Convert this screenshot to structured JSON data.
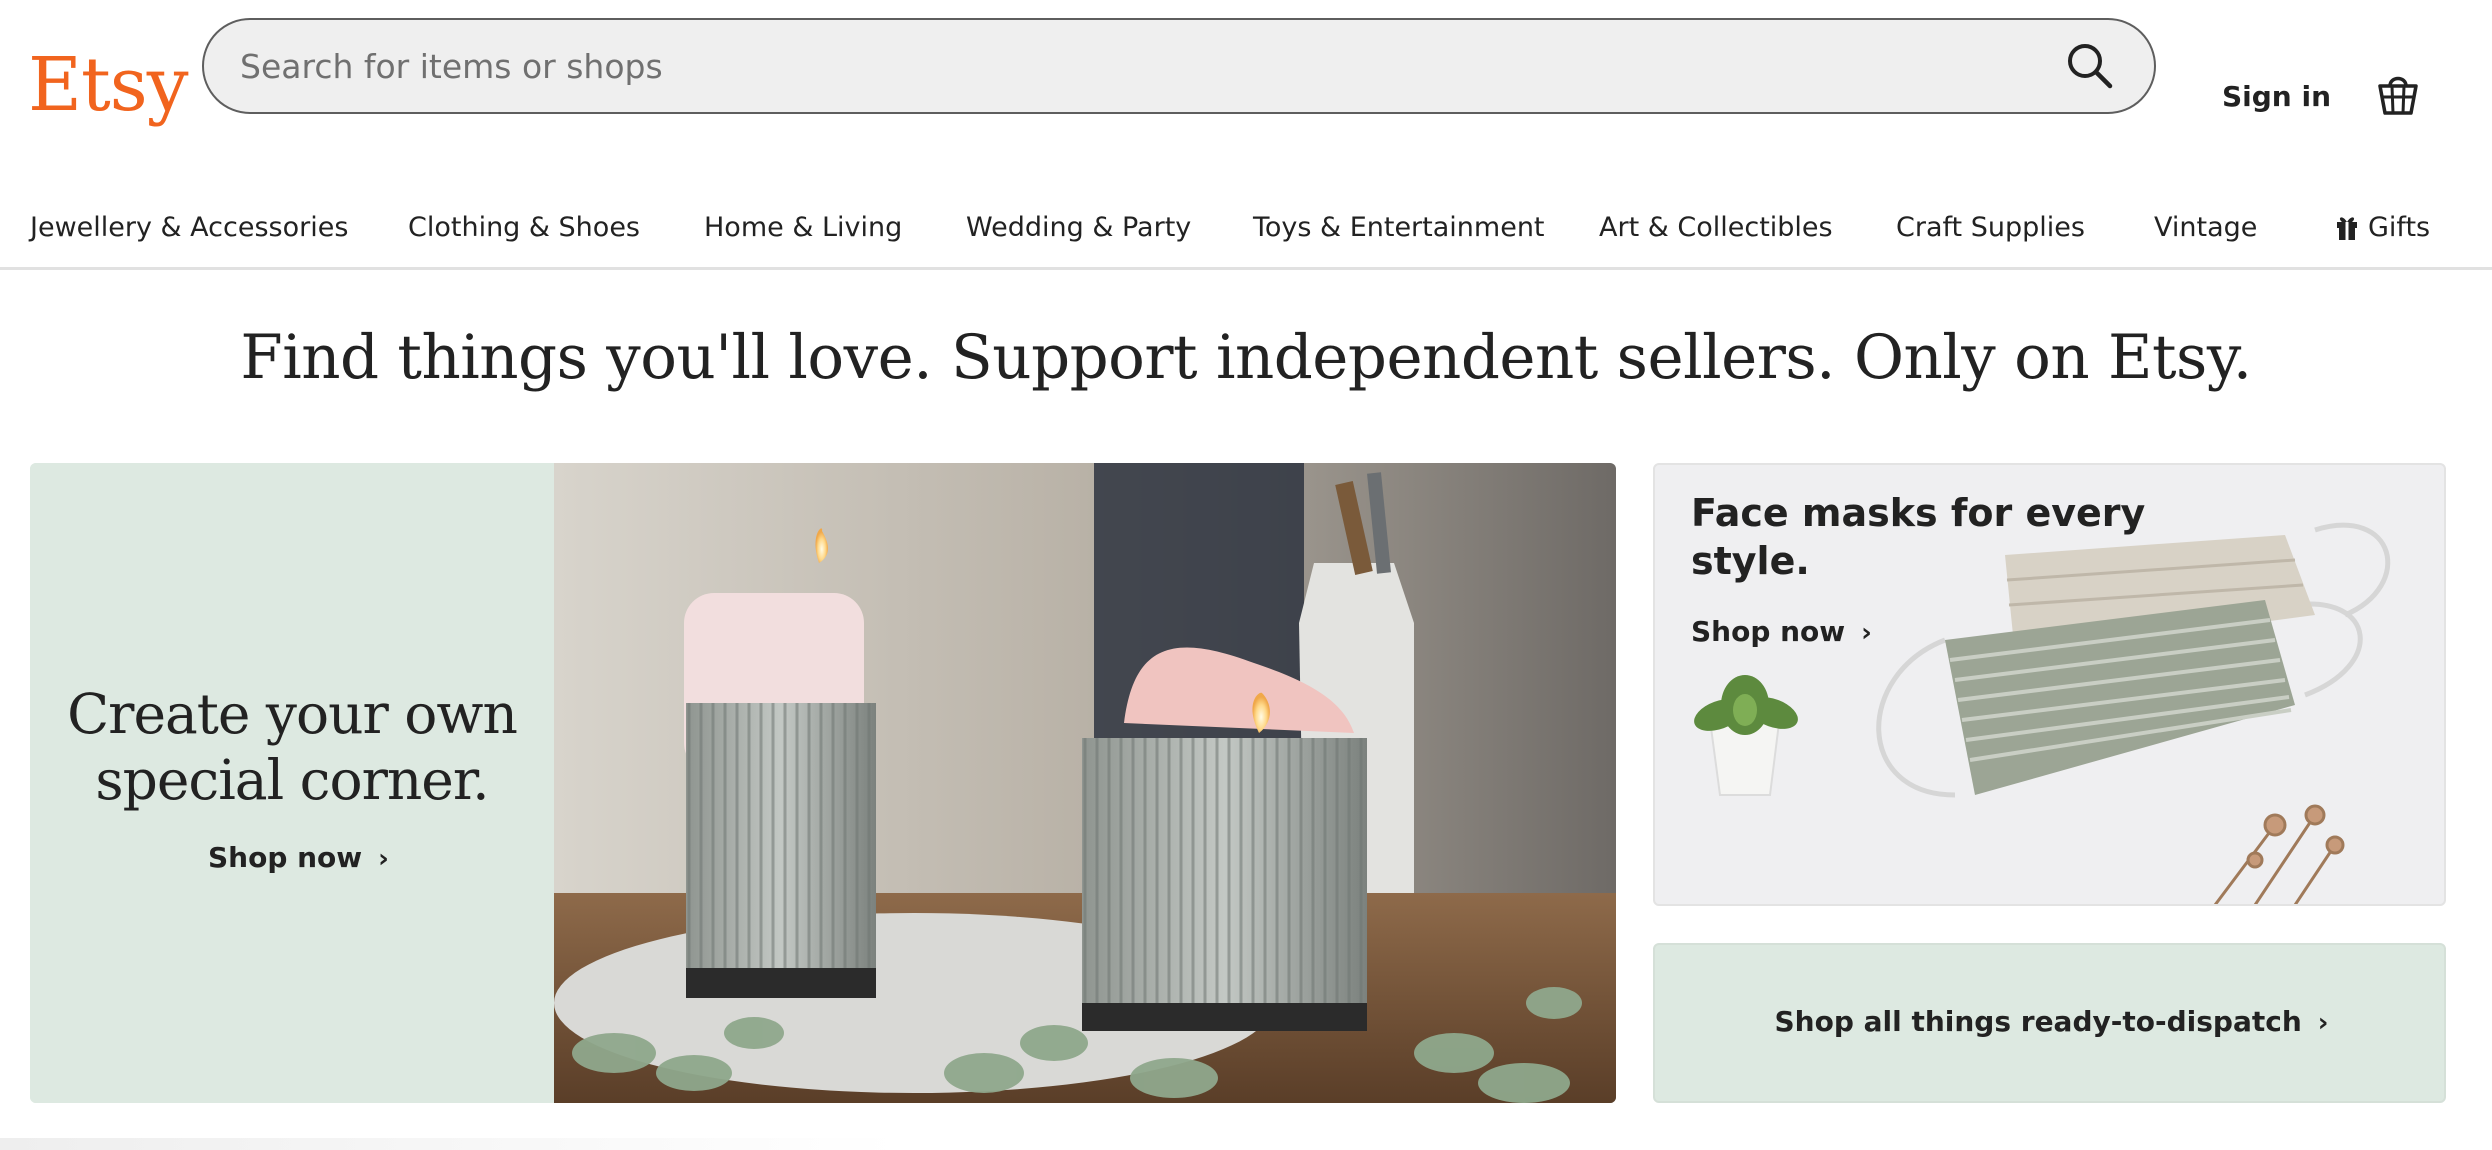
{
  "brand": {
    "logo_text": "Etsy",
    "accent_color": "#f1641e"
  },
  "search": {
    "placeholder": "Search for items or shops",
    "icon": "search-icon"
  },
  "header": {
    "signin_label": "Sign in",
    "basket_icon": "basket-icon"
  },
  "nav": {
    "items": [
      "Jewellery & Accessories",
      "Clothing & Shoes",
      "Home & Living",
      "Wedding & Party",
      "Toys & Entertainment",
      "Art & Collectibles",
      "Craft Supplies",
      "Vintage",
      "Gifts"
    ],
    "gift_icon": "gift-icon"
  },
  "hero": {
    "title": "Find things you'll love. Support independent sellers. Only on Etsy."
  },
  "banner": {
    "heading_line1": "Create your own",
    "heading_line2": "special corner.",
    "cta": "Shop now",
    "background_color": "#dde9e1"
  },
  "masks_card": {
    "title": "Face masks for every style.",
    "cta": "Shop now"
  },
  "dispatch_card": {
    "label": "Shop all things ready-to-dispatch"
  }
}
